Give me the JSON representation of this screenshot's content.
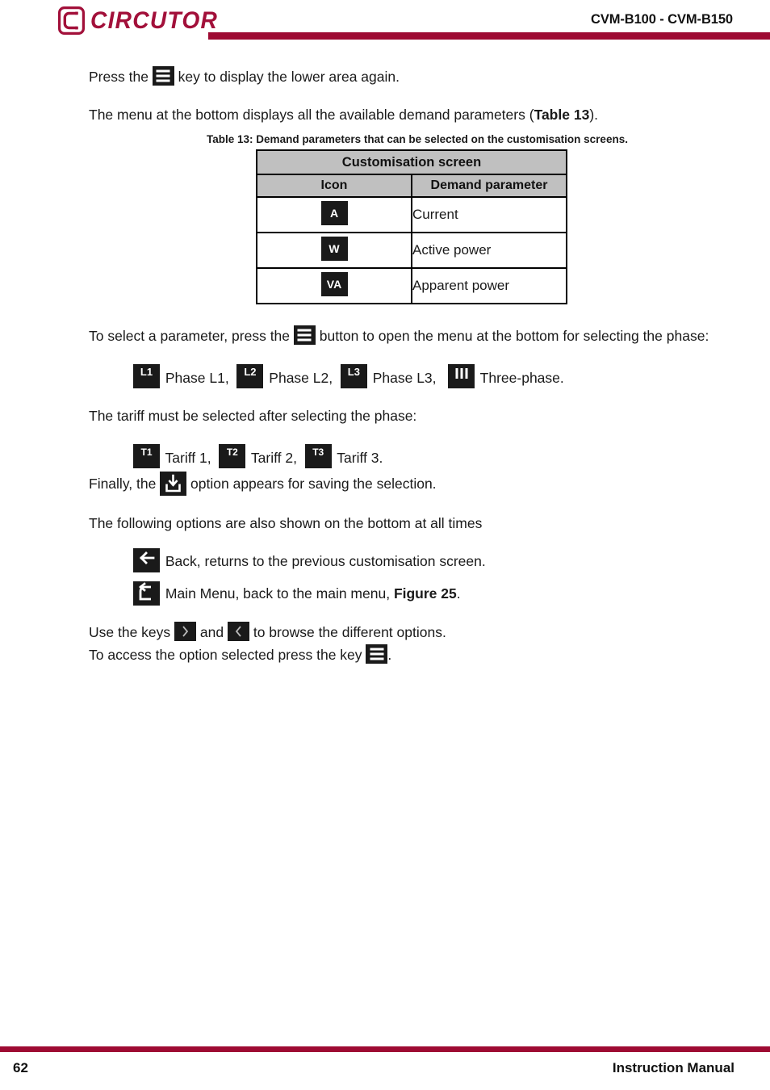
{
  "header": {
    "logo_text": "CIRCUTOR",
    "logo_icon": "circutor-c-logo",
    "product_title": "CVM-B100 - CVM-B150",
    "rule_color": "#9e0b33"
  },
  "content": {
    "paragraph_press_key_pre": "Press the ",
    "paragraph_press_key_post": " key to display the lower area again.",
    "paragraph_menu_bottom_pre": "The menu at the bottom displays all the available demand parameters (",
    "paragraph_menu_bottom_ref": "Table 13",
    "paragraph_menu_bottom_post": ").",
    "paragraph_select_param_pre": "To select a parameter, press the ",
    "paragraph_select_param_post": " button to open the menu at the bottom for selecting the phase:",
    "paragraph_tariff_intro": "The tariff must be selected after selecting the phase:",
    "paragraph_finally_pre": "Finally, the ",
    "paragraph_finally_post": " option appears for saving the selection.",
    "paragraph_following_options": "The following options are also shown on the bottom at all times",
    "paragraph_use_keys_pre": "Use the keys ",
    "paragraph_use_keys_mid": " and ",
    "paragraph_use_keys_post": " to browse the different options.",
    "paragraph_access_option_pre": "To access the option selected press the key ",
    "paragraph_access_option_post": "."
  },
  "table": {
    "caption": "Table 13: Demand parameters that can be selected on the customisation screens.",
    "title": "Customisation screen",
    "columns": [
      "Icon",
      "Demand parameter"
    ],
    "rows": [
      {
        "icon_label": "A",
        "icon_name": "current-icon",
        "parameter": "Current"
      },
      {
        "icon_label": "W",
        "icon_name": "active-power-icon",
        "parameter": "Active power"
      },
      {
        "icon_label": "VA",
        "icon_name": "apparent-power-icon",
        "parameter": "Apparent power"
      }
    ]
  },
  "phase_options": [
    {
      "icon_label": "L1",
      "icon_name": "phase-l1-icon",
      "label": "Phase L1,"
    },
    {
      "icon_label": "L2",
      "icon_name": "phase-l2-icon",
      "label": "Phase L2,"
    },
    {
      "icon_label": "L3",
      "icon_name": "phase-l3-icon",
      "label": "Phase L3,"
    },
    {
      "icon_label": "III",
      "icon_name": "three-phase-icon",
      "label": "Three-phase."
    }
  ],
  "tariff_options": [
    {
      "icon_label": "T1",
      "icon_name": "tariff-1-icon",
      "label": "Tariff 1,"
    },
    {
      "icon_label": "T2",
      "icon_name": "tariff-2-icon",
      "label": "Tariff 2,"
    },
    {
      "icon_label": "T3",
      "icon_name": "tariff-3-icon",
      "label": "Tariff 3."
    }
  ],
  "common_options": [
    {
      "icon_name": "back-arrow-icon",
      "label": "Back, returns to the previous customisation screen."
    },
    {
      "icon_name": "main-menu-return-icon",
      "label_pre": "Main Menu, back to the main menu, ",
      "label_ref": "Figure 25",
      "label_post": "."
    }
  ],
  "icons": {
    "menu_key": "hamburger-menu-icon",
    "save_key": "save-download-icon",
    "next_key": "chevron-right-icon",
    "prev_key": "chevron-left-icon"
  },
  "footer": {
    "page_number": "62",
    "document_title": "Instruction Manual",
    "rule_color": "#9e0b33"
  }
}
